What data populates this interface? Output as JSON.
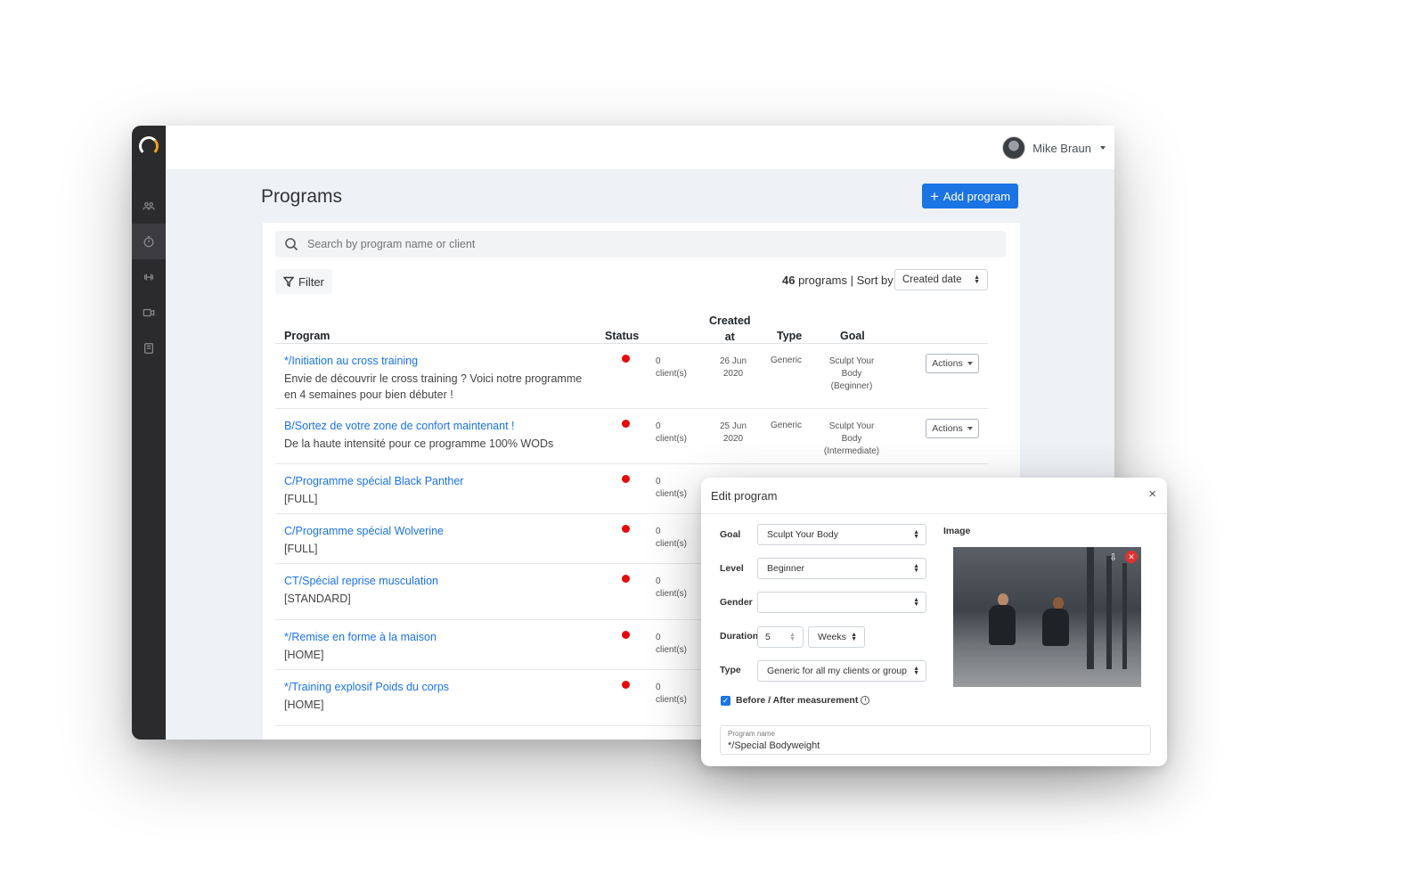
{
  "user": {
    "name": "Mike Braun"
  },
  "sidebar": {
    "items": [
      {
        "icon": "users-icon"
      },
      {
        "icon": "timer-icon",
        "active": true
      },
      {
        "icon": "dumbbell-icon"
      },
      {
        "icon": "video-icon"
      },
      {
        "icon": "book-icon"
      }
    ]
  },
  "page": {
    "title": "Programs",
    "add_button": "Add program"
  },
  "search": {
    "placeholder": "Search by program name or client"
  },
  "filter": {
    "label": "Filter"
  },
  "summary": {
    "count": "46",
    "count_suffix": "programs | Sort by",
    "sort_value": "Created date"
  },
  "table": {
    "headers": {
      "program": "Program",
      "status": "Status",
      "created_line1": "Created",
      "created_line2": "at",
      "type": "Type",
      "goal": "Goal"
    },
    "actions_label": "Actions",
    "rows": [
      {
        "name": "*/Initiation au cross training",
        "desc": "Envie de découvrir le cross training ? Voici notre programme en 4 semaines pour bien débuter !",
        "clients_n": "0",
        "clients_label": "client(s)",
        "date_day": "26 Jun",
        "date_year": "2020",
        "type": "Generic",
        "goal_l1": "Sculpt Your",
        "goal_l2": "Body",
        "goal_l3": "(Beginner)"
      },
      {
        "name": "B/Sortez de votre zone de confort maintenant !",
        "desc": "De la haute intensité pour ce programme 100% WODs",
        "clients_n": "0",
        "clients_label": "client(s)",
        "date_day": "25 Jun",
        "date_year": "2020",
        "type": "Generic",
        "goal_l1": "Sculpt Your",
        "goal_l2": "Body",
        "goal_l3": "(Intermediate)"
      },
      {
        "name": "C/Programme spécial Black Panther",
        "desc": "[FULL]",
        "clients_n": "0",
        "clients_label": "client(s)"
      },
      {
        "name": "C/Programme spécial Wolverine",
        "desc": "[FULL]",
        "clients_n": "0",
        "clients_label": "client(s)"
      },
      {
        "name": "CT/Spécial reprise musculation",
        "desc": "[STANDARD]",
        "clients_n": "0",
        "clients_label": "client(s)"
      },
      {
        "name": "*/Remise en forme à la maison",
        "desc": "[HOME]",
        "clients_n": "0",
        "clients_label": "client(s)"
      },
      {
        "name": "*/Training explosif Poids du corps",
        "desc": "[HOME]",
        "clients_n": "0",
        "clients_label": "client(s)"
      }
    ]
  },
  "modal": {
    "title": "Edit program",
    "close_glyph": "×",
    "goal_label": "Goal",
    "goal_value": "Sculpt Your Body",
    "level_label": "Level",
    "level_value": "Beginner",
    "gender_label": "Gender",
    "gender_value": "",
    "duration_label": "Duration",
    "duration_value": "5",
    "duration_unit": "Weeks",
    "type_label": "Type",
    "type_value": "Generic for all my clients or group",
    "measurement_label": "Before / After measurement",
    "measurement_checked": true,
    "image_label": "Image",
    "program_name_label": "Program name",
    "program_name_value": "*/Special Bodyweight"
  },
  "colors": {
    "accent": "#1b74e4",
    "link": "#1a73e8",
    "status_dot": "#e60b0b",
    "sidebar": "#2b2b2e",
    "page_bg": "#eef1f6"
  }
}
